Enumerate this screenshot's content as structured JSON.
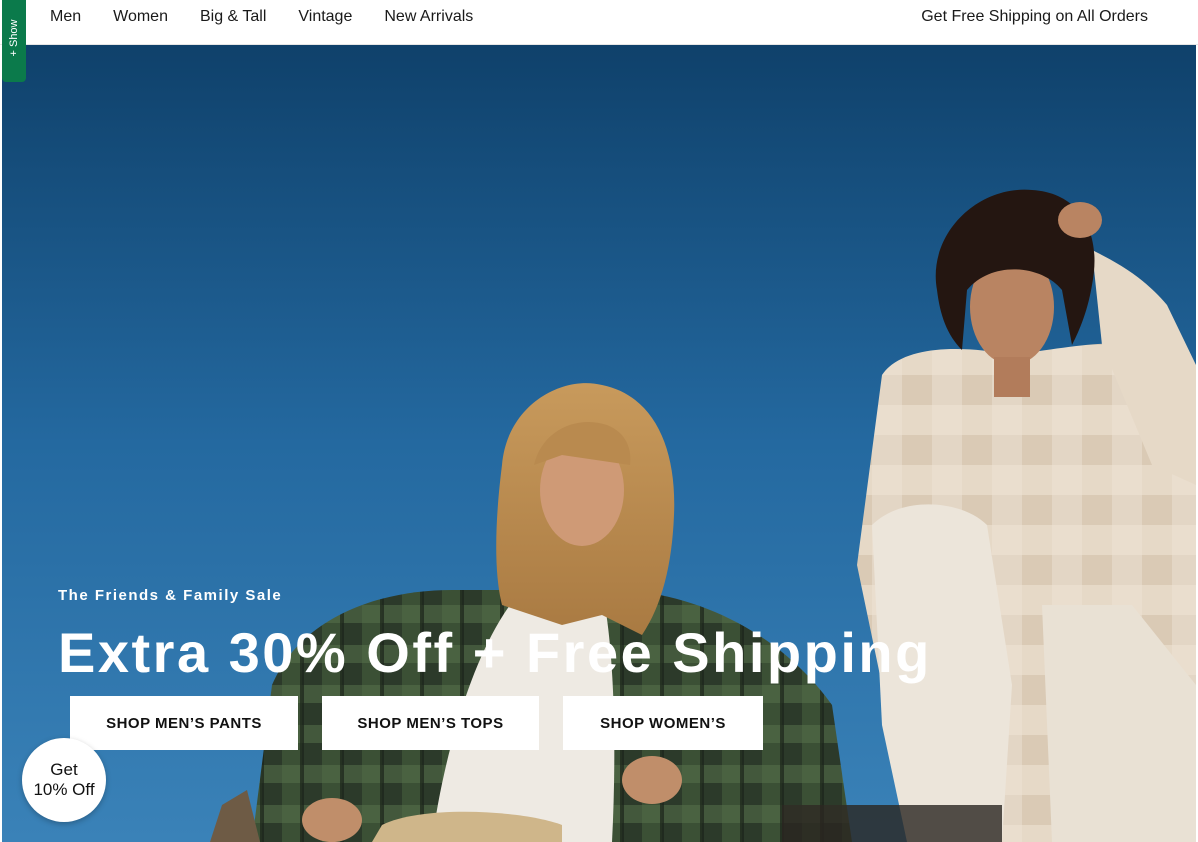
{
  "nav": {
    "links": [
      "Men",
      "Women",
      "Big & Tall",
      "Vintage",
      "New Arrivals"
    ],
    "shipping_note": "Get Free Shipping on All Orders"
  },
  "side_tab": {
    "label": "+ Show",
    "color": "#0b7a4b"
  },
  "hero": {
    "eyebrow": "The Friends & Family Sale",
    "headline": "Extra 30% Off + Free Shipping",
    "buttons": [
      "SHOP MEN’S PANTS",
      "SHOP MEN’S TOPS",
      "SHOP WOMEN’S"
    ],
    "sky_color": "#2a6fa6"
  },
  "promo_badge": {
    "line1": "Get",
    "line2": "10% Off"
  }
}
